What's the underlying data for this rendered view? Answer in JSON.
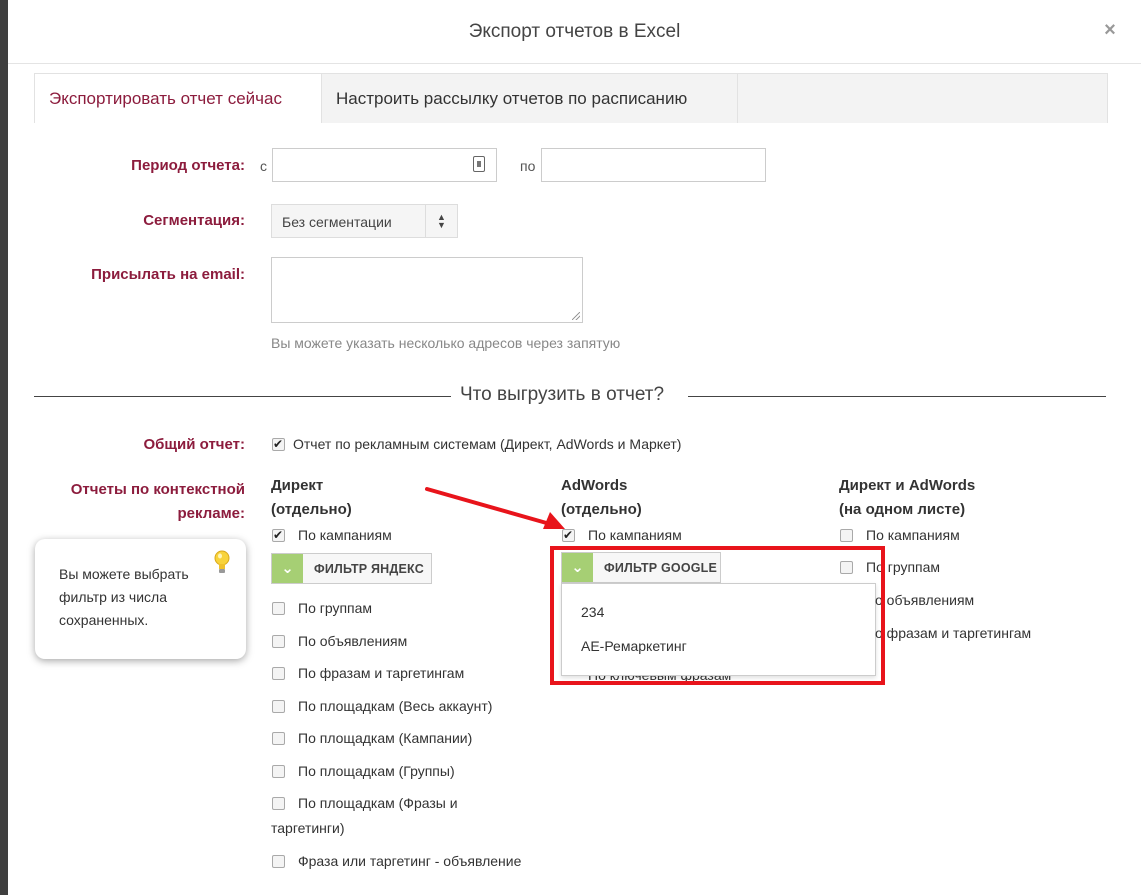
{
  "dialog": {
    "title": "Экспорт отчетов в Excel",
    "close_label": "×"
  },
  "tabs": [
    {
      "label": "Экспортировать отчет сейчас",
      "active": true
    },
    {
      "label": "Настроить рассылку отчетов по расписанию",
      "active": false
    }
  ],
  "form": {
    "period_label": "Период отчета:",
    "from_label": "с",
    "to_label": "по",
    "from_value": "",
    "to_value": "",
    "segmentation_label": "Сегментация:",
    "segmentation_value": "Без сегментации",
    "email_label": "Присылать на email:",
    "email_value": "",
    "email_hint": "Вы можете указать несколько адресов через запятую"
  },
  "section": {
    "title": "Что выгрузить в отчет?"
  },
  "general": {
    "label": "Общий отчет:",
    "option": {
      "label": "Отчет по рекламным системам (Директ, AdWords и Маркет)",
      "checked": true
    }
  },
  "context": {
    "label_line1": "Отчеты по контекстной",
    "label_line2": "рекламе:",
    "direct": {
      "title_line1": "Директ",
      "title_line2": "(отдельно)",
      "by_campaigns": {
        "label": "По кампаниям",
        "checked": true
      },
      "filter_label": "ФИЛЬТР ЯНДЕКС",
      "items": [
        {
          "label": "По группам",
          "checked": false
        },
        {
          "label": "По объявлениям",
          "checked": false
        },
        {
          "label": "По фразам и таргетингам",
          "checked": false
        },
        {
          "label": "По площадкам (Весь аккаунт)",
          "checked": false
        },
        {
          "label": "По площадкам (Кампании)",
          "checked": false
        },
        {
          "label": "По площадкам (Группы)",
          "checked": false
        },
        {
          "label_line1": "По площадкам (Фразы и",
          "label_line2": "таргетинги)",
          "checked": false
        },
        {
          "label": "Фраза или таргетинг - объявление",
          "checked": false
        }
      ]
    },
    "adwords": {
      "title_line1": "AdWords",
      "title_line2": "(отдельно)",
      "by_campaigns": {
        "label": "По кампаниям",
        "checked": true
      },
      "filter_label": "ФИЛЬТР GOOGLE",
      "dropdown_options": [
        "234",
        "АЕ-Ремаркетинг"
      ],
      "hidden_item": "По ключевым фразам"
    },
    "combined": {
      "title_line1": "Директ и AdWords",
      "title_line2": "(на одном листе)",
      "items": [
        {
          "label": "По кампаниям",
          "checked": false
        },
        {
          "label": "По группам",
          "checked": false
        },
        {
          "label": "о объявлениям",
          "checked": false
        },
        {
          "label": "о фразам и таргетингам",
          "checked": false
        }
      ]
    }
  },
  "tooltip": {
    "text": "Вы можете выбрать фильтр из числа сохраненных."
  },
  "colors": {
    "accent": "#8c1c3d",
    "filter_green": "#a6cf74",
    "highlight_red": "#e8141b"
  }
}
